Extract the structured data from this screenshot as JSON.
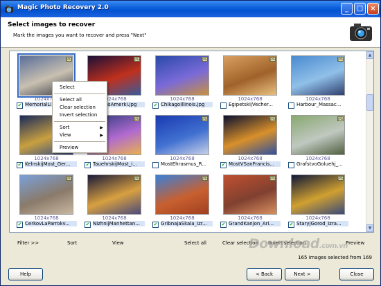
{
  "window": {
    "title": "Magic Photo Recovery 2.0",
    "min_label": "_",
    "max_label": "□",
    "close_label": "×"
  },
  "header": {
    "title": "Select images to recover",
    "subtitle": "Mark the images you want to recover and press \"Next\""
  },
  "grid": {
    "up_arrow": "▲",
    "down_arrow": "▼",
    "tag": "JPG",
    "items": [
      {
        "res": "1024x768",
        "name": "MemorialLinc",
        "checked": true,
        "selected": true,
        "colors": [
          "#5a6f9a",
          "#c9c0b0",
          "#3a3a4a"
        ]
      },
      {
        "res": "1024x768",
        "name": "ImagesAmerki.jpg",
        "checked": true,
        "selected": false,
        "colors": [
          "#1c1038",
          "#c0301c",
          "#3a5a9a"
        ]
      },
      {
        "res": "1024x768",
        "name": "ChikagoIllinois.jpg",
        "checked": true,
        "selected": false,
        "colors": [
          "#2a4aa8",
          "#7a6ad8",
          "#c89040"
        ]
      },
      {
        "res": "1024x768",
        "name": "EgipetskijVecher...",
        "checked": false,
        "selected": false,
        "colors": [
          "#d8a060",
          "#a0622a",
          "#e8c080"
        ]
      },
      {
        "res": "1024x768",
        "name": "Harbour_Massac...",
        "checked": false,
        "selected": false,
        "colors": [
          "#4a8ad0",
          "#90c0e8",
          "#304070"
        ]
      },
      {
        "res": "1024x768",
        "name": "KelnskijMost_Ger...",
        "checked": true,
        "selected": false,
        "colors": [
          "#1a2a5a",
          "#c8a040",
          "#304a8a"
        ]
      },
      {
        "res": "1024x768",
        "name": "TauehrskijMost_i...",
        "checked": true,
        "selected": false,
        "colors": [
          "#283878",
          "#b06ad0",
          "#e8b050"
        ]
      },
      {
        "res": "1024x768",
        "name": "MostEhrasmus_R...",
        "checked": false,
        "selected": false,
        "colors": [
          "#1a3ab0",
          "#4070d0",
          "#c8d0e8"
        ]
      },
      {
        "res": "1024x768",
        "name": "MostVSanFrancis...",
        "checked": true,
        "selected": false,
        "colors": [
          "#0a1030",
          "#d8902a",
          "#3050a0"
        ]
      },
      {
        "res": "1024x768",
        "name": "GrafstvoGoluehj_...",
        "checked": false,
        "selected": false,
        "colors": [
          "#88a870",
          "#c0c8c0",
          "#506040"
        ]
      },
      {
        "res": "1024x768",
        "name": "CerkovLaParrokv...",
        "checked": true,
        "selected": false,
        "colors": [
          "#7aa0d8",
          "#8a7a6a",
          "#c8b8a0"
        ]
      },
      {
        "res": "1024x768",
        "name": "NizhnijManhettan...",
        "checked": true,
        "selected": false,
        "colors": [
          "#1a1a3a",
          "#d8a040",
          "#4a4a7a"
        ]
      },
      {
        "res": "1024x768",
        "name": "GribnajaSkala_Izr...",
        "checked": true,
        "selected": false,
        "colors": [
          "#3a80d8",
          "#c86030",
          "#a04020"
        ]
      },
      {
        "res": "1024x768",
        "name": "GrandKanjon_Ari...",
        "checked": true,
        "selected": false,
        "colors": [
          "#c05030",
          "#804030",
          "#d89060"
        ]
      },
      {
        "res": "1024x768",
        "name": "StaryjGorod_Izra...",
        "checked": true,
        "selected": false,
        "colors": [
          "#101838",
          "#d0a030",
          "#3a4a7a"
        ]
      }
    ]
  },
  "context_menu": {
    "select": "Select",
    "select_all": "Select all",
    "clear_selection": "Clear selection",
    "invert_selection": "Invert selection",
    "sort": "Sort",
    "view": "View",
    "preview": "Preview",
    "submenu_arrow": "▶"
  },
  "toolbar": {
    "filter": "Filter >>",
    "sort": "Sort",
    "view": "View",
    "select_all": "Select all",
    "clear_selection": "Clear selection",
    "invert_selection": "Invert selection",
    "preview": "Preview"
  },
  "watermark": {
    "text": "Download",
    "suffix": ".com.vn"
  },
  "status": {
    "text": "165 images selected from 169"
  },
  "buttons": {
    "help": "Help",
    "back": "< Back",
    "next": "Next >",
    "close": "Close"
  }
}
